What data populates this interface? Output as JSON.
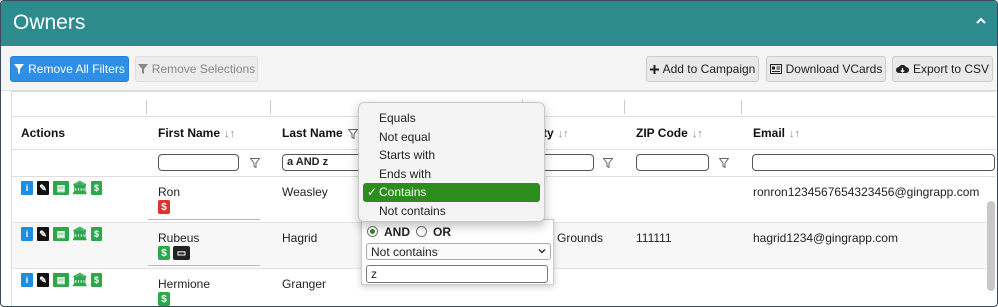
{
  "panel": {
    "title": "Owners"
  },
  "toolbar": {
    "remove_all_filters": "Remove All Filters",
    "remove_selections": "Remove Selections",
    "add_to_campaign": "Add to Campaign",
    "download_vcards": "Download VCards",
    "export_csv": "Export to CSV"
  },
  "columns": {
    "actions": "Actions",
    "first_name": "First Name",
    "last_name": "Last Name",
    "city": "ty",
    "zip": "ZIP Code",
    "email": "Email",
    "sort_glyph": "↓↑"
  },
  "filters": {
    "first_name": "",
    "last_name": "a AND z",
    "city": "",
    "zip": "",
    "email": ""
  },
  "rows": [
    {
      "first_name": "Ron",
      "last_name": "Weasley",
      "city": "",
      "zip": "",
      "email": "ronron1234567654323456@gingrapp.com",
      "badge": "$"
    },
    {
      "first_name": "Rubeus",
      "last_name": "Hagrid",
      "city": "Grounds",
      "zip": "111111",
      "email": "hagrid1234@gingrapp.com",
      "badge": "$"
    },
    {
      "first_name": "Hermione",
      "last_name": "Granger",
      "city": "",
      "zip": "",
      "email": "",
      "badge": "$"
    }
  ],
  "dropdown": {
    "options": [
      "Equals",
      "Not equal",
      "Starts with",
      "Ends with",
      "Contains",
      "Not contains"
    ],
    "selected": "Contains",
    "check": "✓"
  },
  "filter_panel": {
    "and_label": "AND",
    "or_label": "OR",
    "second_condition": "Not contains",
    "second_value": "z"
  },
  "colors": {
    "header": "#2d8b8e",
    "primary_button": "#2f8ee6",
    "selected_option": "#2c8c1c",
    "badge_red": "#e03030",
    "badge_green": "#2ba84a"
  },
  "icons": [
    "filter-icon",
    "plus-icon",
    "vcard-icon",
    "cloud-download-icon",
    "chevron-up-icon",
    "info-icon",
    "edit-icon",
    "id-card-icon",
    "bank-icon",
    "invoice-icon",
    "dollar-icon",
    "card-badge-icon"
  ]
}
